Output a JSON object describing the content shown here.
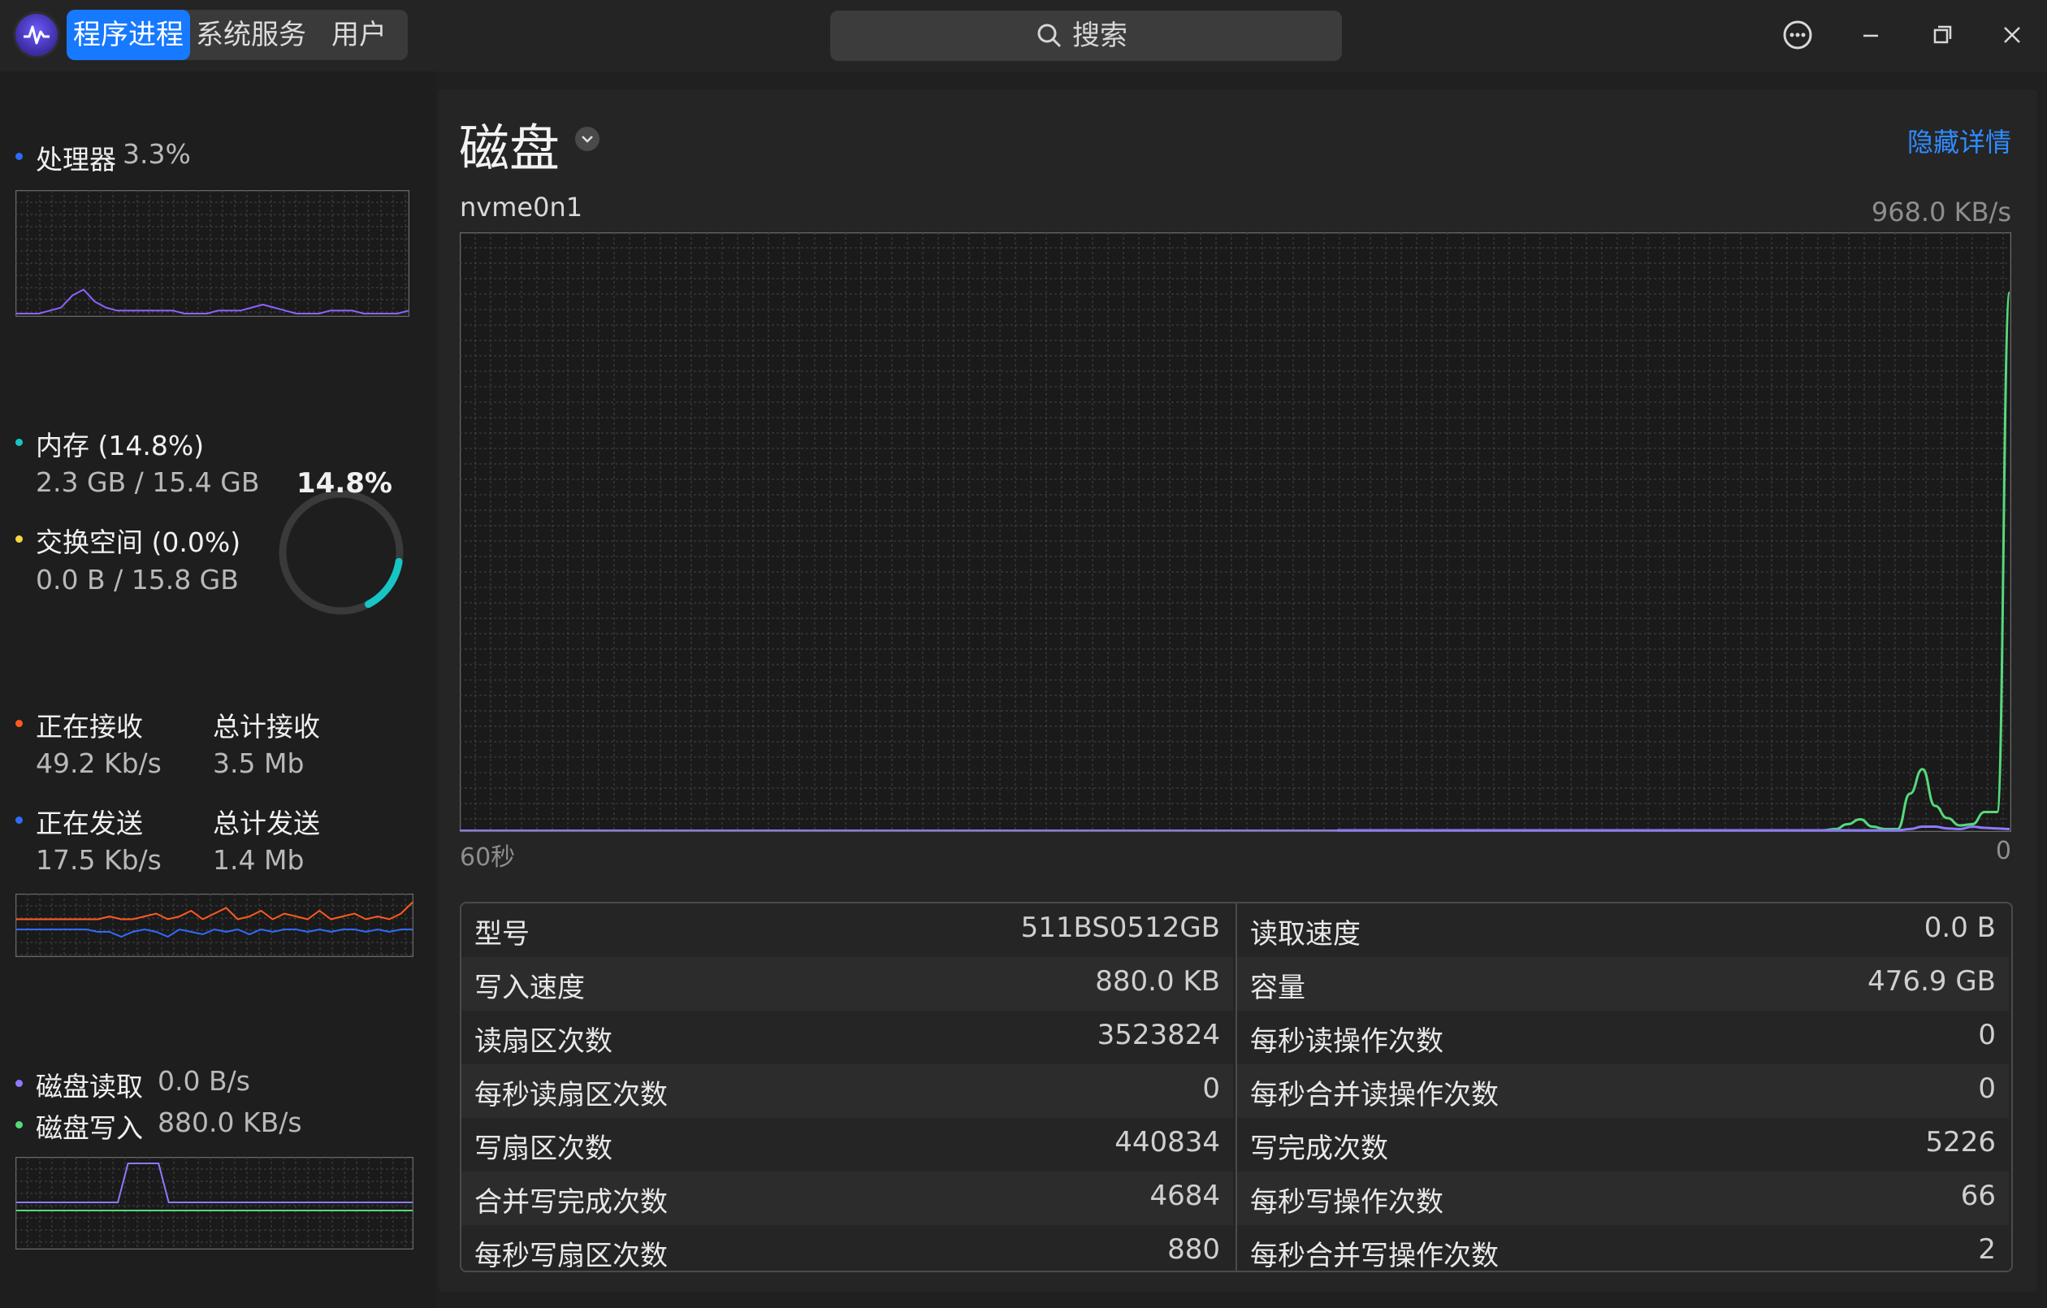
{
  "app": {
    "tabs": [
      "程序进程",
      "系统服务",
      "用户"
    ],
    "active_tab": 0,
    "search_placeholder": "搜索"
  },
  "colors": {
    "accent": "#1779ff",
    "cpu": "#8a63ff",
    "memory": "#17c5c5",
    "swap": "#f5d742",
    "net_recv": "#ff5a1f",
    "net_send": "#2f6bff",
    "disk_read": "#8a7bff",
    "disk_write": "#56d97b"
  },
  "sidebar": {
    "cpu": {
      "label": "处理器",
      "value": "3.3%",
      "series": [
        0,
        0,
        0,
        1,
        2,
        6,
        8,
        4,
        2,
        1,
        1,
        1,
        1,
        1,
        1,
        0,
        0,
        0,
        1,
        1,
        1,
        2,
        3,
        2,
        1,
        0,
        0,
        0,
        1,
        1,
        1,
        0,
        0,
        0,
        0,
        1
      ]
    },
    "memory": {
      "label": "内存 (14.8%)",
      "usage": "2.3 GB / 15.4 GB",
      "ring_text": "14.8%",
      "ring_fraction": 0.148
    },
    "swap": {
      "label": "交换空间 (0.0%)",
      "usage": "0.0 B / 15.8 GB"
    },
    "network": {
      "recv_label": "正在接收",
      "recv_value": "49.2 Kb/s",
      "total_recv_label": "总计接收",
      "total_recv_value": "3.5 Mb",
      "send_label": "正在发送",
      "send_value": "17.5 Kb/s",
      "total_send_label": "总计发送",
      "total_send_value": "1.4 Mb",
      "recv_series": [
        3,
        3,
        3,
        3,
        3,
        3,
        3,
        3,
        4,
        3,
        3,
        4,
        5,
        3,
        4,
        6,
        3,
        5,
        7,
        3,
        4,
        6,
        3,
        5,
        4,
        3,
        6,
        3,
        4,
        5,
        3,
        4,
        3,
        5,
        9
      ],
      "send_series": [
        2,
        2,
        2,
        2,
        2,
        2,
        2,
        1,
        1,
        -1,
        1,
        2,
        1,
        -1,
        2,
        1,
        0,
        2,
        1,
        2,
        0,
        2,
        1,
        2,
        2,
        1,
        2,
        1,
        2,
        2,
        1,
        2,
        1,
        2,
        2
      ]
    },
    "disk": {
      "read_label": "磁盘读取",
      "read_value": "0.0 B/s",
      "write_label": "磁盘写入",
      "write_value": "880.0 KB/s"
    }
  },
  "main": {
    "title": "磁盘",
    "hide_details": "隐藏详情",
    "device": "nvme0n1",
    "max_value": "968.0 KB/s",
    "x_left": "60秒",
    "x_right": "0",
    "chart_data": {
      "type": "line",
      "x_range_seconds": [
        60,
        0
      ],
      "ylim": [
        0,
        968.0
      ],
      "y_unit": "KB/s",
      "series": [
        {
          "name": "磁盘写入",
          "values": [
            0,
            0,
            0,
            0,
            0,
            0,
            0,
            0,
            0,
            0,
            0,
            0,
            0,
            0,
            0,
            0,
            0,
            0,
            0,
            0,
            0,
            0,
            0,
            0,
            0,
            0,
            0,
            0,
            0,
            0,
            0,
            0,
            0,
            0,
            0,
            0,
            0,
            0,
            0,
            0,
            2,
            10,
            18,
            6,
            2,
            2,
            60,
            100,
            40,
            20,
            8,
            10,
            30,
            30,
            880
          ]
        },
        {
          "name": "磁盘读取",
          "values": [
            0,
            0,
            0,
            0,
            0,
            0,
            0,
            0,
            0,
            0,
            0,
            0,
            0,
            0,
            0,
            0,
            0,
            0,
            0,
            0,
            0,
            0,
            0,
            0,
            0,
            0,
            0,
            0,
            0,
            0,
            0,
            0,
            0,
            0,
            0,
            0,
            0,
            0,
            0,
            0,
            0,
            0,
            0,
            0,
            0,
            0,
            2,
            6,
            6,
            3,
            2,
            6,
            4,
            3,
            2
          ]
        }
      ]
    },
    "details": {
      "left": [
        {
          "key": "型号",
          "value": "511BS0512GB"
        },
        {
          "key": "写入速度",
          "value": "880.0 KB"
        },
        {
          "key": "读扇区次数",
          "value": "3523824"
        },
        {
          "key": "每秒读扇区次数",
          "value": "0"
        },
        {
          "key": "写扇区次数",
          "value": "440834"
        },
        {
          "key": "合并写完成次数",
          "value": "4684"
        },
        {
          "key": "每秒写扇区次数",
          "value": "880"
        }
      ],
      "right": [
        {
          "key": "读取速度",
          "value": "0.0 B"
        },
        {
          "key": "容量",
          "value": "476.9 GB"
        },
        {
          "key": "每秒读操作次数",
          "value": "0"
        },
        {
          "key": "每秒合并读操作次数",
          "value": "0"
        },
        {
          "key": "写完成次数",
          "value": "5226"
        },
        {
          "key": "每秒写操作次数",
          "value": "66"
        },
        {
          "key": "每秒合并写操作次数",
          "value": "2"
        }
      ]
    }
  }
}
